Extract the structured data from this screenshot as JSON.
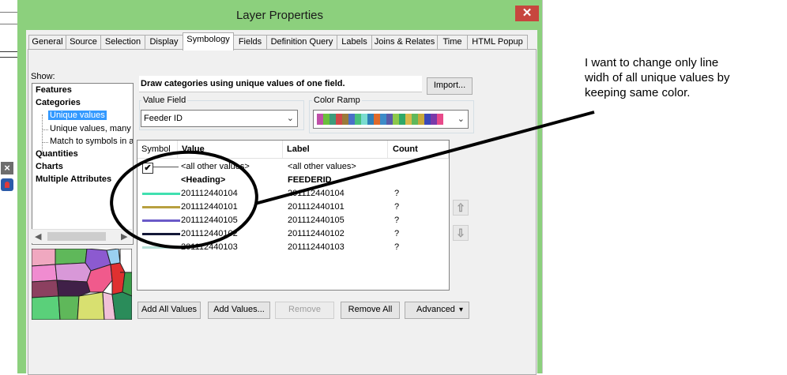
{
  "window": {
    "title": "Layer Properties",
    "close_glyph": "✕"
  },
  "tabs": [
    {
      "label": "General",
      "active": false
    },
    {
      "label": "Source",
      "active": false
    },
    {
      "label": "Selection",
      "active": false
    },
    {
      "label": "Display",
      "active": false
    },
    {
      "label": "Symbology",
      "active": true
    },
    {
      "label": "Fields",
      "active": false
    },
    {
      "label": "Definition Query",
      "active": false
    },
    {
      "label": "Labels",
      "active": false
    },
    {
      "label": "Joins & Relates",
      "active": false
    },
    {
      "label": "Time",
      "active": false
    },
    {
      "label": "HTML Popup",
      "active": false
    }
  ],
  "show": {
    "label": "Show:",
    "items": [
      {
        "label": "Features",
        "bold": true
      },
      {
        "label": "Categories",
        "bold": true
      },
      {
        "label": "Unique values",
        "selected": true
      },
      {
        "label": "Unique values, many"
      },
      {
        "label": "Match to symbols in a"
      },
      {
        "label": "Quantities",
        "bold": true
      },
      {
        "label": "Charts",
        "bold": true
      },
      {
        "label": "Multiple Attributes",
        "bold": true
      }
    ]
  },
  "description": "Draw categories using unique values of one field.",
  "import_label": "Import...",
  "value_field": {
    "label": "Value Field",
    "value": "Feeder ID"
  },
  "color_ramp": {
    "label": "Color Ramp",
    "colors": [
      "#c04fa8",
      "#6abf3c",
      "#3d9c7c",
      "#d04848",
      "#9a7a3a",
      "#4a6fc8",
      "#48c07c",
      "#7adcd0",
      "#2f7fb8",
      "#e06a2a",
      "#3d8cc8",
      "#5a5aa8",
      "#8cc84a",
      "#2fa868",
      "#d8b84a",
      "#5fb85a",
      "#c8a83a",
      "#3a48b8",
      "#7a3aa8",
      "#e84a8a"
    ]
  },
  "table": {
    "headers": {
      "symbol": "Symbol",
      "value": "Value",
      "label": "Label",
      "count": "Count"
    },
    "other_row": {
      "value": "<all other values>",
      "label": "<all other values>",
      "checked": "✔"
    },
    "heading_row": {
      "value": "<Heading>",
      "label": "FEEDERID"
    },
    "rows": [
      {
        "color": "#40e0b0",
        "value": "201112440104",
        "label": "201112440104",
        "count": "?"
      },
      {
        "color": "#b8a040",
        "value": "201112440101",
        "label": "201112440101",
        "count": "?"
      },
      {
        "color": "#6a5ac8",
        "value": "201112440105",
        "label": "201112440105",
        "count": "?"
      },
      {
        "color": "#141838",
        "value": "201112440102",
        "label": "201112440102",
        "count": "?"
      },
      {
        "color": "#b8e0d8",
        "value": "201112440103",
        "label": "201112440103",
        "count": "?"
      }
    ]
  },
  "buttons": {
    "add_all": "Add All Values",
    "add_values": "Add Values...",
    "remove": "Remove",
    "remove_all": "Remove All",
    "advanced": "Advanced",
    "advanced_arrow": "▾"
  },
  "side_arrows": {
    "up": "⇧",
    "down": "⇩"
  },
  "annotation": "I want to change only line widh of all unique values by keeping same color."
}
